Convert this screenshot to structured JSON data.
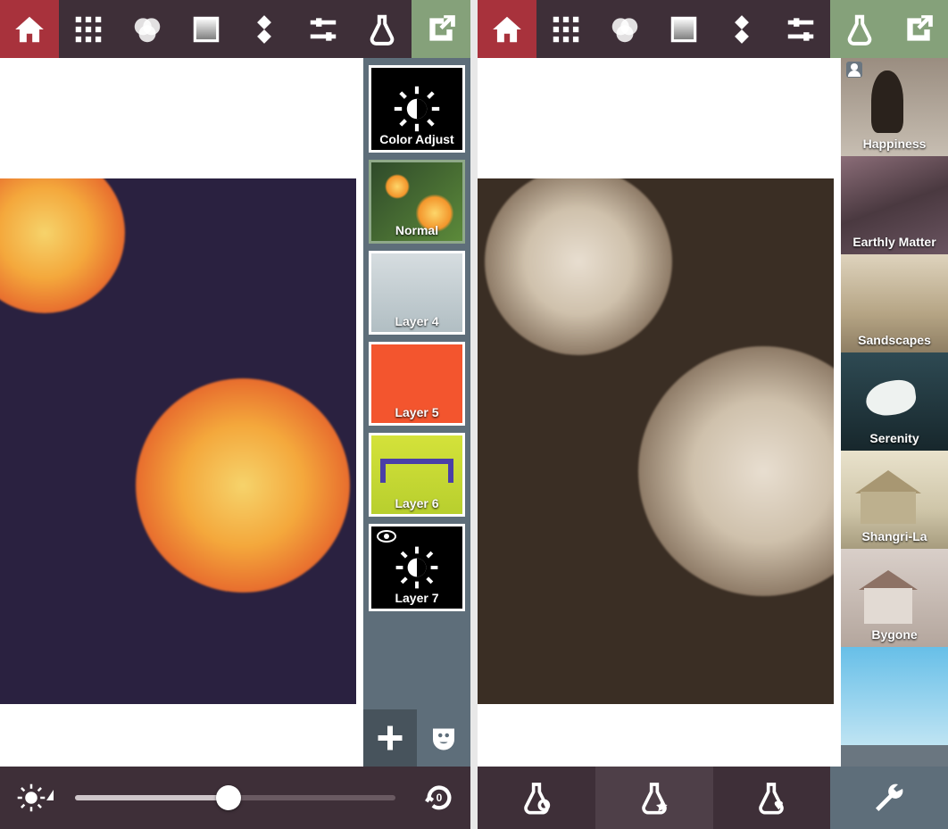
{
  "toolbar_icons": [
    "home",
    "texture",
    "channels",
    "gradient",
    "shapes",
    "sliders",
    "lab",
    "share"
  ],
  "leftScreen": {
    "layers": {
      "color_adjust": "Color Adjust",
      "normal": "Normal",
      "layer4": "Layer 4",
      "layer5": "Layer 5",
      "layer6": "Layer 6",
      "layer7": "Layer 7"
    },
    "layer5_color": "#f3552e",
    "bottom": {
      "slider_value_pct": 48,
      "reset_label": "0"
    }
  },
  "rightScreen": {
    "formulas": {
      "happiness": "Happiness",
      "earthly": "Earthly Matter",
      "sand": "Sandscapes",
      "serenity": "Serenity",
      "shangrila": "Shangri-La",
      "bygone": "Bygone"
    },
    "bottom_tabs": [
      "formula-manage",
      "formula-featured",
      "formula-favorites",
      "settings"
    ]
  }
}
